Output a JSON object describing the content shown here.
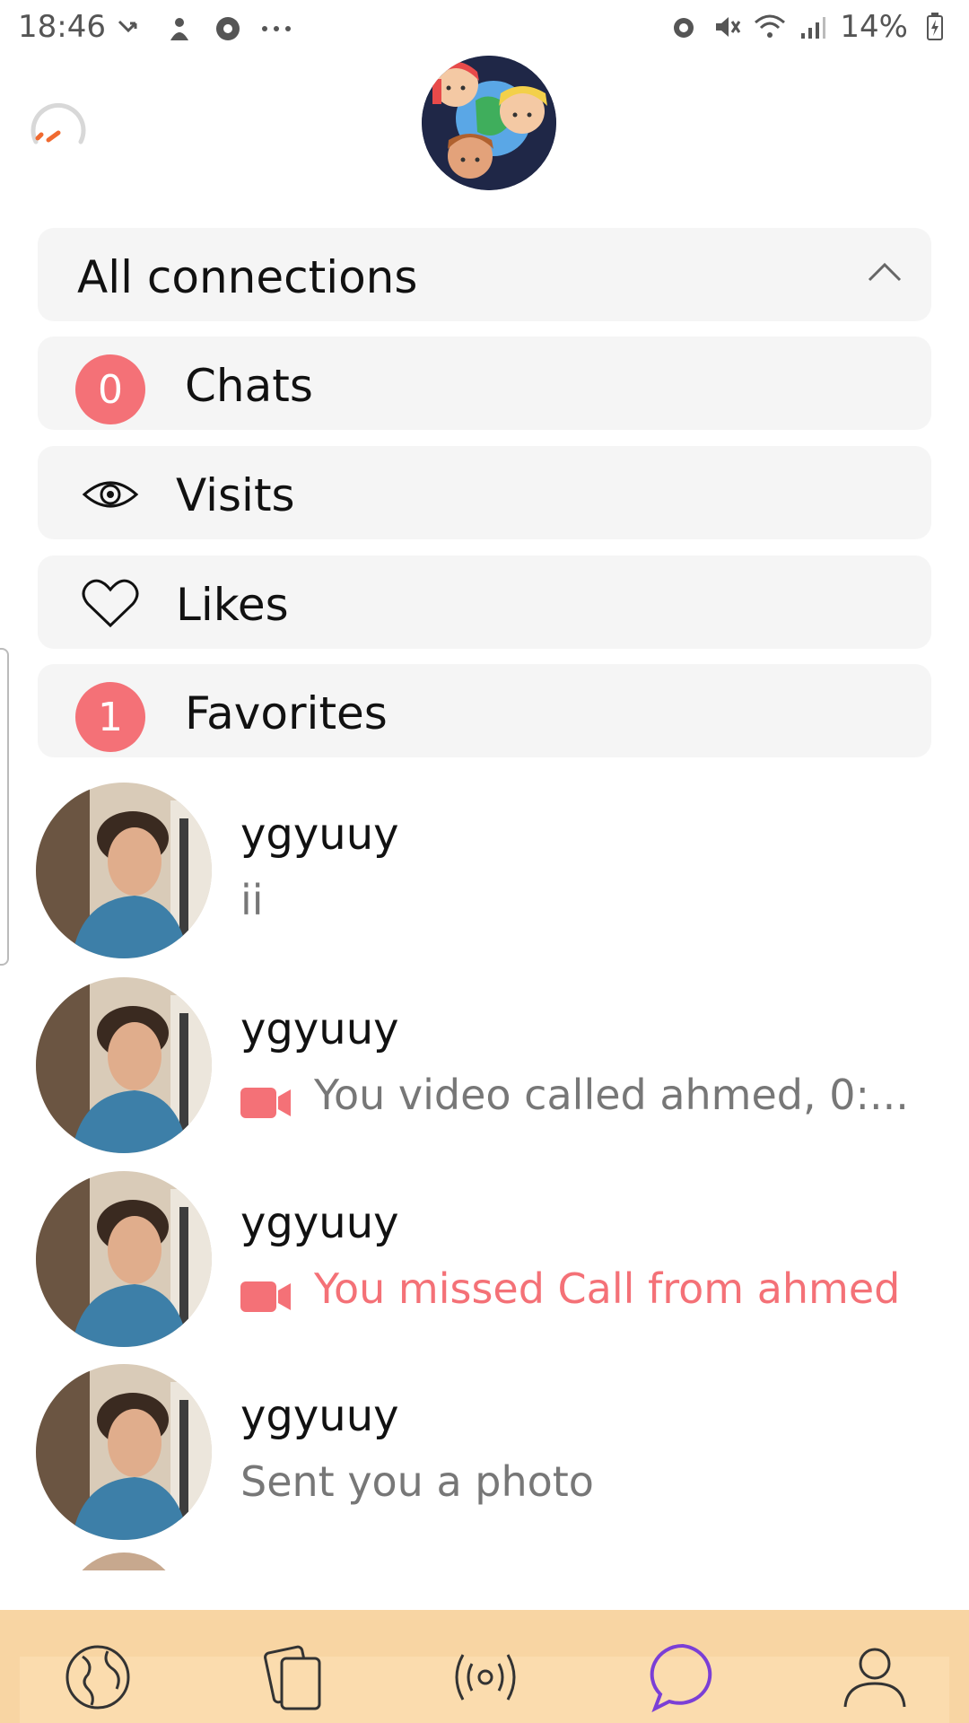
{
  "status_bar": {
    "time": "18:46",
    "battery_text": "14%",
    "left_icons": [
      "missed-call-icon",
      "notification-icon",
      "soccer-icon",
      "more-icon"
    ],
    "right_icons": [
      "alarm-icon",
      "mute-icon",
      "wifi-icon",
      "signal-icon",
      "battery-icon"
    ]
  },
  "header": {
    "speed_icon": "speedometer-icon",
    "group_avatar": "group-avatar"
  },
  "connections": {
    "header_label": "All connections",
    "items": [
      {
        "label": "Chats",
        "badge": "0"
      },
      {
        "label": "Visits",
        "icon": "eye-icon"
      },
      {
        "label": "Likes",
        "icon": "heart-icon"
      },
      {
        "label": "Favorites",
        "badge": "1"
      }
    ]
  },
  "chats": [
    {
      "name": "ygyuuy",
      "message": "ii",
      "type": "text"
    },
    {
      "name": "ygyuuy",
      "message": "You video called ahmed, 0:...",
      "type": "video"
    },
    {
      "name": "ygyuuy",
      "message": "You missed Call from ahmed",
      "type": "missed"
    },
    {
      "name": "ygyuuy",
      "message": "Sent you a photo",
      "type": "text"
    }
  ],
  "bottom_nav": {
    "items": [
      "globe-icon",
      "cards-icon",
      "broadcast-icon",
      "chat-icon",
      "profile-icon"
    ],
    "active": "chat-icon"
  },
  "colors": {
    "accent": "#f47177",
    "active_nav": "#7b3fd6",
    "nav_bg": "#f8d5a3",
    "panel_bg": "#f5f5f5"
  }
}
